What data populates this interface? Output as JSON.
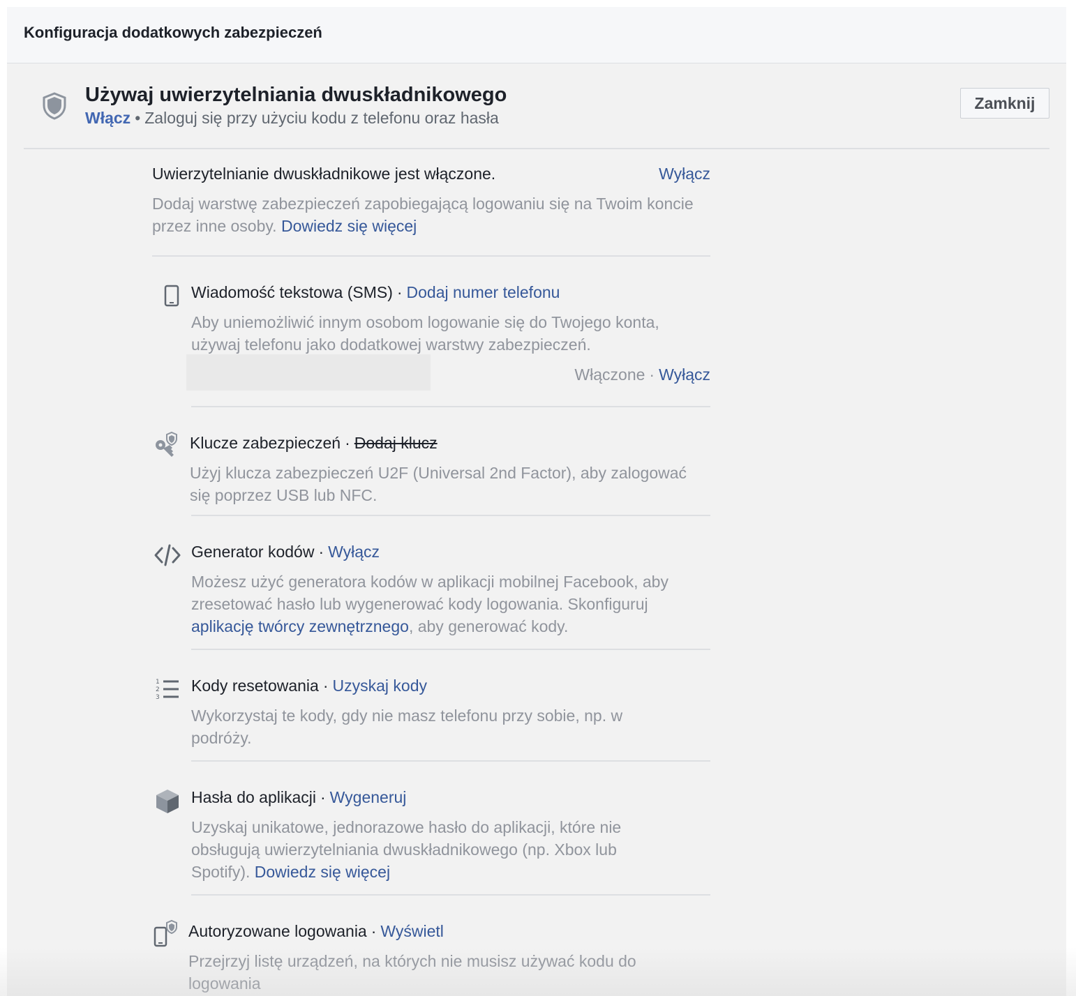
{
  "header": {
    "title": "Konfiguracja dodatkowych zabezpieczeń"
  },
  "tfa": {
    "title": "Używaj uwierzytelniania dwuskładnikowego",
    "enable_label": "Włącz",
    "separator": "•",
    "subtitle": "Zaloguj się przy użyciu kodu z telefonu oraz hasła",
    "close_label": "Zamknij",
    "icon": "shield-icon"
  },
  "status": {
    "title": "Uwierzytelnianie dwuskładnikowe jest włączone.",
    "disable_label": "Wyłącz",
    "desc": "Dodaj warstwę zabezpieczeń zapobiegającą logowaniu się na Twoim koncie przez inne osoby.",
    "learn_more": "Dowiedz się więcej"
  },
  "methods": {
    "sms": {
      "title": "Wiadomość tekstowa (SMS)",
      "action": "Dodaj numer telefonu",
      "desc": "Aby uniemożliwić innym osobom logowanie się do Twojego konta, używaj telefonu jako dodatkowej warstwy zabezpieczeń.",
      "status": "Włączone",
      "status_action": "Wyłącz",
      "icon": "phone-icon"
    },
    "keys": {
      "title": "Klucze zabezpieczeń",
      "action": "Dodaj klucz",
      "desc": "Użyj klucza zabezpieczeń U2F (Universal 2nd Factor), aby zalogować się poprzez USB lub NFC.",
      "icon": "security-key-icon"
    },
    "generator": {
      "title": "Generator kodów",
      "action": "Wyłącz",
      "desc_1": "Możesz użyć generatora kodów w aplikacji mobilnej Facebook, aby zresetować hasło lub wygenerować kody logowania.",
      "desc_2": "Skonfiguruj",
      "desc_link": "aplikację twórcy zewnętrznego",
      "desc_3": ", aby generować kody.",
      "icon": "code-icon"
    },
    "reset": {
      "title": "Kody resetowania",
      "action": "Uzyskaj kody",
      "desc": "Wykorzystaj te kody, gdy nie masz telefonu przy sobie, np. w podróży.",
      "icon": "numbered-list-icon"
    },
    "app_passwords": {
      "title": "Hasła do aplikacji",
      "action": "Wygeneruj",
      "desc": "Uzyskaj unikatowe, jednorazowe hasło do aplikacji, które nie obsługują uwierzytelniania dwuskładnikowego (np. Xbox lub Spotify).",
      "learn_more": "Dowiedz się więcej",
      "icon": "cube-icon"
    },
    "authorized": {
      "title": "Autoryzowane logowania",
      "action": "Wyświetl",
      "desc": "Przejrzyj listę urządzeń, na których nie musisz używać kodu do logowania",
      "icon": "authorized-device-icon"
    }
  },
  "separator_dot": "·"
}
